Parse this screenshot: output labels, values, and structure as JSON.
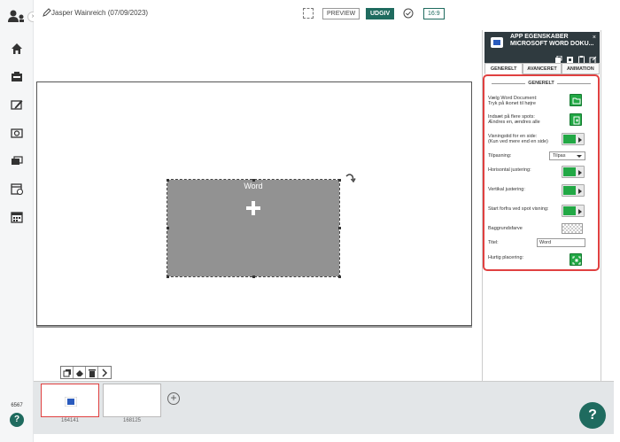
{
  "header": {
    "user_label": "Jasper Wainreich (07/09/2023)",
    "preview_label": "PREVIEW",
    "publish_label": "UDGIV",
    "ratio_label": "16:9"
  },
  "sidebar": {
    "count_label": "6567",
    "help_label": "?",
    "icons": [
      "users-icon",
      "home-icon",
      "display-icon",
      "edit-screen-icon",
      "media-icon",
      "cards-icon",
      "schedule-icon",
      "calendar-icon"
    ]
  },
  "canvas": {
    "app_title": "Word"
  },
  "filmstrip": {
    "slides": [
      {
        "label": "164141"
      },
      {
        "label": "168125"
      }
    ],
    "add_label": "+"
  },
  "help_fab": "?",
  "panel": {
    "title_line1": "APP EGENSKABER",
    "title_line2": "MICROSOFT WORD DOKU...",
    "close_label": "×",
    "tabs": [
      "GENERELT",
      "AVANCERET",
      "ANIMATION"
    ],
    "section_title": "GENERELT",
    "fields": {
      "choose_doc_line1": "Vælg Word Document:",
      "choose_doc_line2": "Tryk på ikonet til højre",
      "multi_spots_line1": "Indsæt på flere spots:",
      "multi_spots_line2": "Ændres en, ændres alle",
      "display_time_line1": "Visningstid for en side:",
      "display_time_line2": "(Kun ved mere end en side)",
      "fit_label": "Tilpasning:",
      "fit_value": "Tilpas",
      "h_align_label": "Horisontal justering:",
      "v_align_label": "Vertikal justering:",
      "restart_label": "Start forfra ved spot visning:",
      "bg_color_label": "Baggrundsfarve",
      "title_label": "Titel:",
      "title_value": "Word",
      "quick_place_label": "Hurtig placering:"
    }
  },
  "colors": {
    "accent": "#1f6b5f",
    "highlight": "#e04040",
    "button_green": "#22a845",
    "panel_header": "#2f3a3f"
  }
}
